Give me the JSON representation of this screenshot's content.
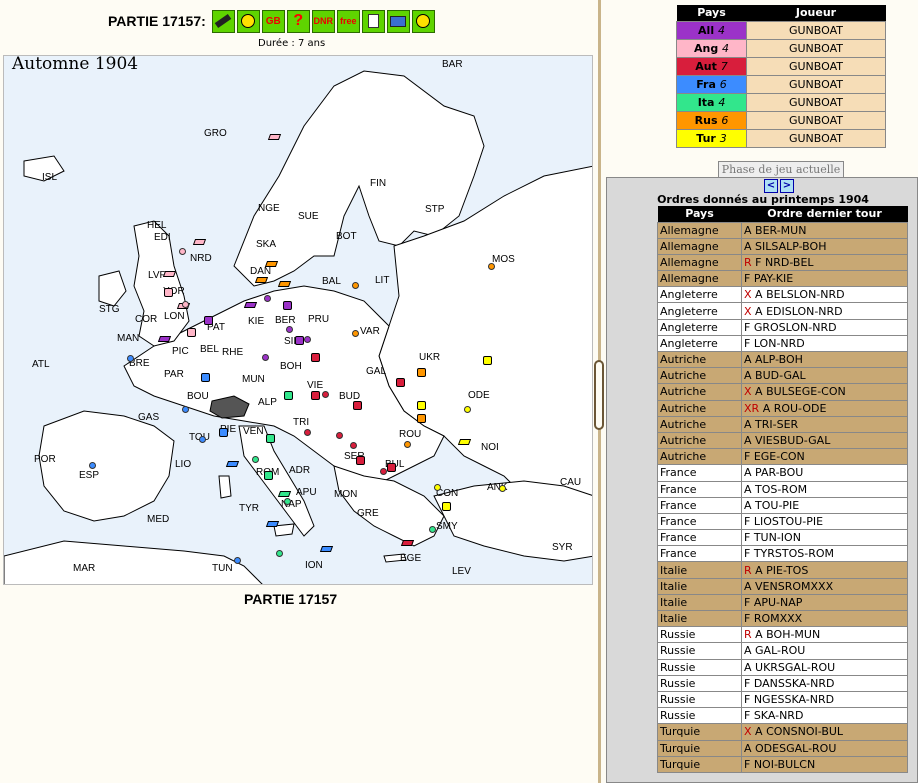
{
  "header": {
    "title": "PARTIE 17157:",
    "duration": "Durée : 7 ans",
    "toolbar": [
      {
        "name": "gavel-icon",
        "label": ""
      },
      {
        "name": "smiley-icon",
        "label": ""
      },
      {
        "name": "gb-icon",
        "label": "GB"
      },
      {
        "name": "help-icon",
        "label": "?"
      },
      {
        "name": "dnr-icon",
        "label": "DNR"
      },
      {
        "name": "free-icon",
        "label": "free"
      },
      {
        "name": "document-icon",
        "label": ""
      },
      {
        "name": "screen-icon",
        "label": ""
      },
      {
        "name": "angry-face-icon",
        "label": ""
      }
    ]
  },
  "map": {
    "season": "Automne 1904",
    "caption": "PARTIE 17157",
    "provinces": [
      "BAR",
      "GRO",
      "FIN",
      "STP",
      "ISL",
      "NGE",
      "SUE",
      "HEL",
      "BOT",
      "NRD",
      "SKA",
      "MOS",
      "DAN",
      "BAL",
      "LIT",
      "EDI",
      "LVP",
      "YOR",
      "STG",
      "LON",
      "KIE",
      "BER",
      "PRU",
      "VAR",
      "MAN",
      "COR",
      "PIC",
      "PAT",
      "BEL",
      "SIL",
      "RHE",
      "ATL",
      "BRE",
      "UKR",
      "PAR",
      "MUN",
      "BOH",
      "GAL",
      "VIE",
      "BUD",
      "ODE",
      "BOU",
      "ALP",
      "GAS",
      "TRI",
      "ROU",
      "TOU",
      "PIE",
      "VEN",
      "NOI",
      "POR",
      "LIO",
      "ESP",
      "SER",
      "BUL",
      "ANK",
      "CAU",
      "CON",
      "ROM",
      "ADR",
      "APU",
      "MON",
      "NAP",
      "SMY",
      "MED",
      "TYR",
      "GRE",
      "EGE",
      "SYR",
      "MAR",
      "TUN",
      "ION",
      "LEV"
    ]
  },
  "players": {
    "headers": {
      "pays": "Pays",
      "joueur": "Joueur"
    },
    "rows": [
      {
        "code": "All",
        "sc": "4",
        "player": "GUNBOAT",
        "color": "#9b32c8"
      },
      {
        "code": "Ang",
        "sc": "4",
        "player": "GUNBOAT",
        "color": "#ffb6c8"
      },
      {
        "code": "Aut",
        "sc": "7",
        "player": "GUNBOAT",
        "color": "#d81e3c"
      },
      {
        "code": "Fra",
        "sc": "6",
        "player": "GUNBOAT",
        "color": "#3c8cff"
      },
      {
        "code": "Ita",
        "sc": "4",
        "player": "GUNBOAT",
        "color": "#32e68c"
      },
      {
        "code": "Rus",
        "sc": "6",
        "player": "GUNBOAT",
        "color": "#ff9600"
      },
      {
        "code": "Tur",
        "sc": "3",
        "player": "GUNBOAT",
        "color": "#ffff00"
      }
    ]
  },
  "phase_button": "Phase de jeu actuelle",
  "orders": {
    "prev": "<",
    "next": ">",
    "title": "Ordres donnés au printemps 1904",
    "headers": {
      "pays": "Pays",
      "ordre": "Ordre dernier tour"
    },
    "rows": [
      {
        "pays": "Allemagne",
        "flag": "",
        "order": "A BER-MUN"
      },
      {
        "pays": "Allemagne",
        "flag": "",
        "order": "A SILSALP-BOH"
      },
      {
        "pays": "Allemagne",
        "flag": "R",
        "order": "F NRD-BEL"
      },
      {
        "pays": "Allemagne",
        "flag": "",
        "order": "F PAY-KIE"
      },
      {
        "pays": "Angleterre",
        "flag": "X",
        "order": "A BELSLON-NRD"
      },
      {
        "pays": "Angleterre",
        "flag": "X",
        "order": "A EDISLON-NRD"
      },
      {
        "pays": "Angleterre",
        "flag": "",
        "order": "F GROSLON-NRD"
      },
      {
        "pays": "Angleterre",
        "flag": "",
        "order": "F LON-NRD"
      },
      {
        "pays": "Autriche",
        "flag": "",
        "order": "A ALP-BOH"
      },
      {
        "pays": "Autriche",
        "flag": "",
        "order": "A BUD-GAL"
      },
      {
        "pays": "Autriche",
        "flag": "X",
        "order": "A BULSEGE-CON"
      },
      {
        "pays": "Autriche",
        "flag": "XR",
        "order": "A ROU-ODE"
      },
      {
        "pays": "Autriche",
        "flag": "",
        "order": "A TRI-SER"
      },
      {
        "pays": "Autriche",
        "flag": "",
        "order": "A VIESBUD-GAL"
      },
      {
        "pays": "Autriche",
        "flag": "",
        "order": "F EGE-CON"
      },
      {
        "pays": "France",
        "flag": "",
        "order": "A PAR-BOU"
      },
      {
        "pays": "France",
        "flag": "",
        "order": "A TOS-ROM"
      },
      {
        "pays": "France",
        "flag": "",
        "order": "A TOU-PIE"
      },
      {
        "pays": "France",
        "flag": "",
        "order": "F LIOSTOU-PIE"
      },
      {
        "pays": "France",
        "flag": "",
        "order": "F TUN-ION"
      },
      {
        "pays": "France",
        "flag": "",
        "order": "F TYRSTOS-ROM"
      },
      {
        "pays": "Italie",
        "flag": "R",
        "order": "A PIE-TOS"
      },
      {
        "pays": "Italie",
        "flag": "",
        "order": "A VENSROMXXX"
      },
      {
        "pays": "Italie",
        "flag": "",
        "order": "F APU-NAP"
      },
      {
        "pays": "Italie",
        "flag": "",
        "order": "F ROMXXX"
      },
      {
        "pays": "Russie",
        "flag": "R",
        "order": "A BOH-MUN"
      },
      {
        "pays": "Russie",
        "flag": "",
        "order": "A GAL-ROU"
      },
      {
        "pays": "Russie",
        "flag": "",
        "order": "A UKRSGAL-ROU"
      },
      {
        "pays": "Russie",
        "flag": "",
        "order": "F DANSSKA-NRD"
      },
      {
        "pays": "Russie",
        "flag": "",
        "order": "F NGESSKA-NRD"
      },
      {
        "pays": "Russie",
        "flag": "",
        "order": "F SKA-NRD"
      },
      {
        "pays": "Turquie",
        "flag": "X",
        "order": "A CONSNOI-BUL"
      },
      {
        "pays": "Turquie",
        "flag": "",
        "order": "A ODESGAL-ROU"
      },
      {
        "pays": "Turquie",
        "flag": "",
        "order": "F NOI-BULCN"
      }
    ]
  }
}
